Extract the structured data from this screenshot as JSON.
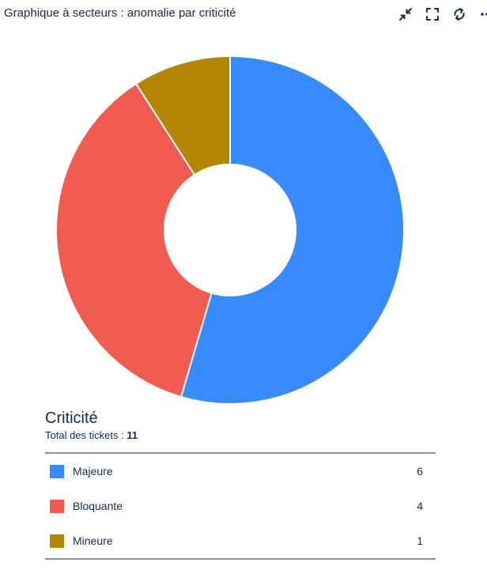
{
  "header": {
    "title": "Graphique à secteurs : anomalie par criticité"
  },
  "toolbar": {
    "icons": [
      "minimize-icon",
      "fullscreen-icon",
      "refresh-icon",
      "more-icon"
    ]
  },
  "chart_data": {
    "type": "pie",
    "variant": "donut",
    "categories": [
      "Majeure",
      "Bloquante",
      "Mineure"
    ],
    "values": [
      6,
      4,
      1
    ],
    "colors": [
      "#388bff",
      "#f15b50",
      "#b38600"
    ],
    "legend_placement": "bottom"
  },
  "legend": {
    "title": "Criticité",
    "total_label": "Total des tickets :",
    "total_value": "11"
  }
}
